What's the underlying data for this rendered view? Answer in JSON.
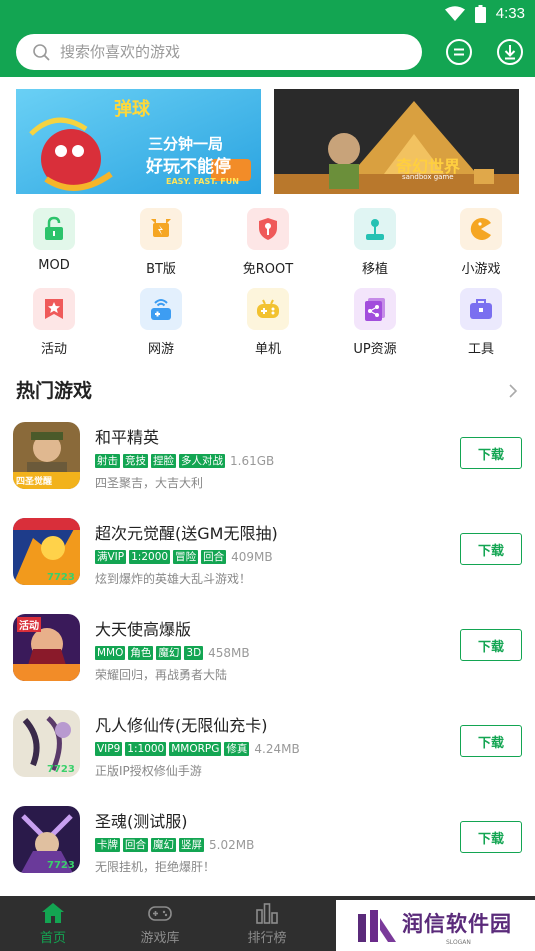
{
  "status_bar": {
    "time": "4:33"
  },
  "search": {
    "placeholder": "搜索你喜欢的游戏"
  },
  "header_actions": [
    "message-icon",
    "download-icon"
  ],
  "banners": [
    {
      "lines": [
        "弹球",
        "三分钟一局",
        "好玩不能停"
      ],
      "subtitle": "EASY. FAST. FUN"
    },
    {
      "lines": [
        "奇幻世界"
      ],
      "subtitle": "sandbox game"
    }
  ],
  "categories": [
    {
      "label": "MOD",
      "icon": "unlock-icon",
      "color": "#2cc36b"
    },
    {
      "label": "BT版",
      "icon": "bt-icon",
      "color": "#f5a623"
    },
    {
      "label": "免ROOT",
      "icon": "shield-key-icon",
      "color": "#ef5a5a"
    },
    {
      "label": "移植",
      "icon": "joystick-icon",
      "color": "#26c1b3"
    },
    {
      "label": "小游戏",
      "icon": "pacman-icon",
      "color": "#f5a623"
    },
    {
      "label": "活动",
      "icon": "star-badge-icon",
      "color": "#ef5a5a"
    },
    {
      "label": "网游",
      "icon": "network-game-icon",
      "color": "#3d9df2"
    },
    {
      "label": "单机",
      "icon": "gamepad-icon",
      "color": "#f2c230"
    },
    {
      "label": "UP资源",
      "icon": "share-icon",
      "color": "#a24ddc"
    },
    {
      "label": "工具",
      "icon": "toolbox-icon",
      "color": "#7a6ff0"
    }
  ],
  "section": {
    "title": "热门游戏"
  },
  "games": [
    {
      "name": "和平精英",
      "tags": [
        "射击",
        "竞技",
        "捏脸",
        "多人对战"
      ],
      "size": "1.61GB",
      "desc": "四圣聚吉，大吉大利",
      "button": "下载",
      "badge": "四圣觉醒"
    },
    {
      "name": "超次元觉醒(送GM无限抽)",
      "tags": [
        "满VIP",
        "1:2000",
        "冒险",
        "回合"
      ],
      "size": "409MB",
      "desc": "炫到爆炸的英雄大乱斗游戏！",
      "button": "下载",
      "badge": "7723"
    },
    {
      "name": "大天使高爆版",
      "tags": [
        "MMO",
        "角色",
        "魔幻",
        "3D"
      ],
      "size": "458MB",
      "desc": "荣耀回归，再战勇者大陆",
      "button": "下载",
      "badge": "活动"
    },
    {
      "name": "凡人修仙传(无限仙充卡)",
      "tags": [
        "VIP9",
        "1:1000",
        "MMORPG",
        "修真"
      ],
      "size": "4.24MB",
      "desc": "正版IP授权修仙手游",
      "button": "下载",
      "badge": "7723"
    },
    {
      "name": "圣魂(测试服)",
      "tags": [
        "卡牌",
        "回合",
        "魔幻",
        "竖屏"
      ],
      "size": "5.02MB",
      "desc": "无限挂机，拒绝爆肝！",
      "button": "下载",
      "badge": "7723"
    }
  ],
  "nav": [
    {
      "label": "首页",
      "icon": "home-icon",
      "active": true
    },
    {
      "label": "游戏库",
      "icon": "gamepad-icon",
      "active": false
    },
    {
      "label": "排行榜",
      "icon": "ranking-icon",
      "active": false
    }
  ],
  "watermark": {
    "text": "润信软件园",
    "slogan": "SLOGAN"
  },
  "colors": {
    "brand_green": "#13a552",
    "nav_bg": "#2f2f2f"
  }
}
